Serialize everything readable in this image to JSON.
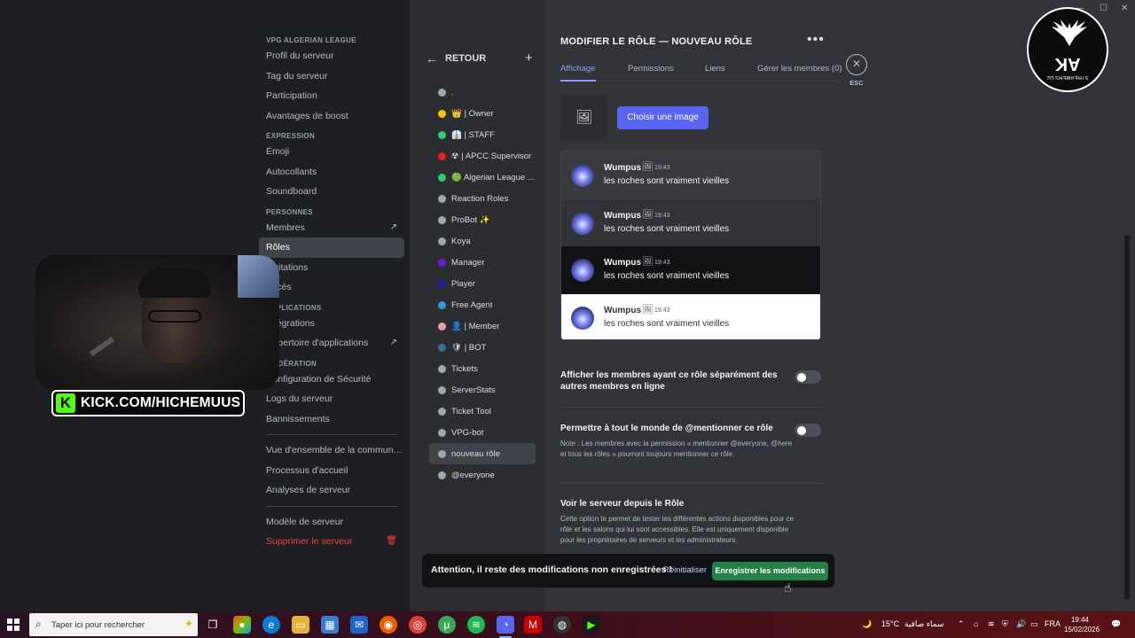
{
  "sidebar": {
    "sections": [
      {
        "header": "VPG ALGERIAN LEAGUE",
        "items": [
          {
            "label": "Profil du serveur"
          },
          {
            "label": "Tag du serveur"
          },
          {
            "label": "Participation"
          },
          {
            "label": "Avantages de boost"
          }
        ]
      },
      {
        "header": "EXPRESSION",
        "items": [
          {
            "label": "Émoji"
          },
          {
            "label": "Autocollants"
          },
          {
            "label": "Soundboard"
          }
        ]
      },
      {
        "header": "PERSONNES",
        "items": [
          {
            "label": "Membres",
            "trail": "↗"
          },
          {
            "label": "Rôles",
            "active": true
          },
          {
            "label": "Invitations"
          },
          {
            "label": "Accès"
          }
        ]
      },
      {
        "header": "APPLICATIONS",
        "items": [
          {
            "label": "Intégrations"
          },
          {
            "label": "Répertoire d'applications",
            "trail": "↗"
          }
        ]
      },
      {
        "header": "MODÉRATION",
        "items": [
          {
            "label": "Configuration de Sécurité"
          },
          {
            "label": "Logs du serveur"
          },
          {
            "label": "Bannissements"
          }
        ]
      }
    ],
    "extra_items": [
      {
        "label": "Vue d'ensemble de la communauté"
      },
      {
        "label": "Processus d'accueil"
      },
      {
        "label": "Analyses de serveur"
      }
    ],
    "footer_items": [
      {
        "label": "Modèle de serveur"
      },
      {
        "label": "Supprimer le serveur",
        "danger": true,
        "trail": "🗑"
      }
    ]
  },
  "overlay": {
    "kick_letter": "K",
    "kick_text": "KICK.COM/HICHEMUUS"
  },
  "roles_panel": {
    "back_label": "RETOUR",
    "add_label": "+",
    "roles": [
      {
        "label": ".",
        "color": "#99aab5"
      },
      {
        "label": "👑 | Owner",
        "color": "#f1c40f"
      },
      {
        "label": "👔 | STAFF",
        "color": "#2ecc71"
      },
      {
        "label": "☢ | APCC Supervisor",
        "color": "#e91e1e"
      },
      {
        "label": "🟢 Algerian League ...",
        "color": "#2ecc71"
      },
      {
        "label": "Reaction Roles",
        "color": "#99aab5"
      },
      {
        "label": "ProBot ✨",
        "color": "#99aab5"
      },
      {
        "label": "Koya",
        "color": "#99aab5"
      },
      {
        "label": "Manager",
        "color": "#6a1bd6"
      },
      {
        "label": "Player",
        "color": "#2a1b9c"
      },
      {
        "label": "Free Agent",
        "color": "#3498db"
      },
      {
        "label": "👤 | Member",
        "color": "#e8a0a0"
      },
      {
        "label": "🛡 | BOT",
        "color": "#3b6d96"
      },
      {
        "label": "Tickets",
        "color": "#99aab5"
      },
      {
        "label": "ServerStats",
        "color": "#99aab5"
      },
      {
        "label": "Ticket Tool",
        "color": "#99aab5"
      },
      {
        "label": "VPG-bot",
        "color": "#99aab5"
      },
      {
        "label": "nouveau rôle",
        "color": "#99aab5",
        "selected": true
      },
      {
        "label": "@everyone",
        "color": "#99aab5"
      }
    ]
  },
  "main": {
    "title": "MODIFIER LE RÔLE — NOUVEAU RÔLE",
    "more": "•••",
    "tabs": [
      {
        "label": "Affichage",
        "active": true
      },
      {
        "label": "Permissions"
      },
      {
        "label": "Liens"
      },
      {
        "label": "Gérer les membres (0)"
      }
    ],
    "esc_icon": "✕",
    "esc_label": "ESC",
    "image_icon": "🖼",
    "choose_image_label": "Choisir une image",
    "preview_messages": [
      {
        "name": "Wumpus",
        "badge": "🖼",
        "time": "19:43",
        "text": "les roches sont vraiment vieilles"
      },
      {
        "name": "Wumpus",
        "badge": "🖼",
        "time": "19:43",
        "text": "les roches sont vraiment vieilles"
      },
      {
        "name": "Wumpus",
        "badge": "🖼",
        "time": "19:43",
        "text": "les roches sont vraiment vieilles"
      },
      {
        "name": "Wumpus",
        "badge": "🖼",
        "time": "19:43",
        "text": "les roches sont vraiment vieilles"
      }
    ],
    "settings": [
      {
        "title": "Afficher les membres ayant ce rôle séparément des autres membres en ligne",
        "desc": "",
        "enabled": false
      },
      {
        "title": "Permettre à tout le monde de @mentionner ce rôle",
        "desc": "Note : Les membres avec la permission « mentionner @everyone, @here et tous les rôles » pourront toujours mentionner ce rôle.",
        "enabled": false
      }
    ],
    "view_as": {
      "title": "Voir le serveur depuis le Rôle",
      "desc": "Cette option te permet de tester les différentes actions disponibles pour ce rôle et les salons qui lui sont accessibles. Elle est uniquement disponible pour les propriétaires de serveurs et les administrateurs."
    }
  },
  "unsaved_bar": {
    "message": "Attention, il reste des modifications non enregistrées !",
    "reset_label": "Réinitialiser",
    "save_label": "Enregistrer les modifications"
  },
  "window": {
    "minimize": "—",
    "maximize": "☐",
    "close": "✕"
  },
  "logo": {
    "letters": "AK",
    "subtitle": "STREAMERS DZ"
  },
  "taskbar": {
    "search_placeholder": "Taper ici pour rechercher",
    "weather_temp": "15°C",
    "weather_desc": "سماء صافية",
    "language": "FRA",
    "time": "19:44",
    "date": "15/02/2026"
  },
  "colors": {
    "accent": "#5865f2",
    "save_green": "#248046",
    "danger": "#f23f43",
    "tab_active": "#949cf7"
  }
}
